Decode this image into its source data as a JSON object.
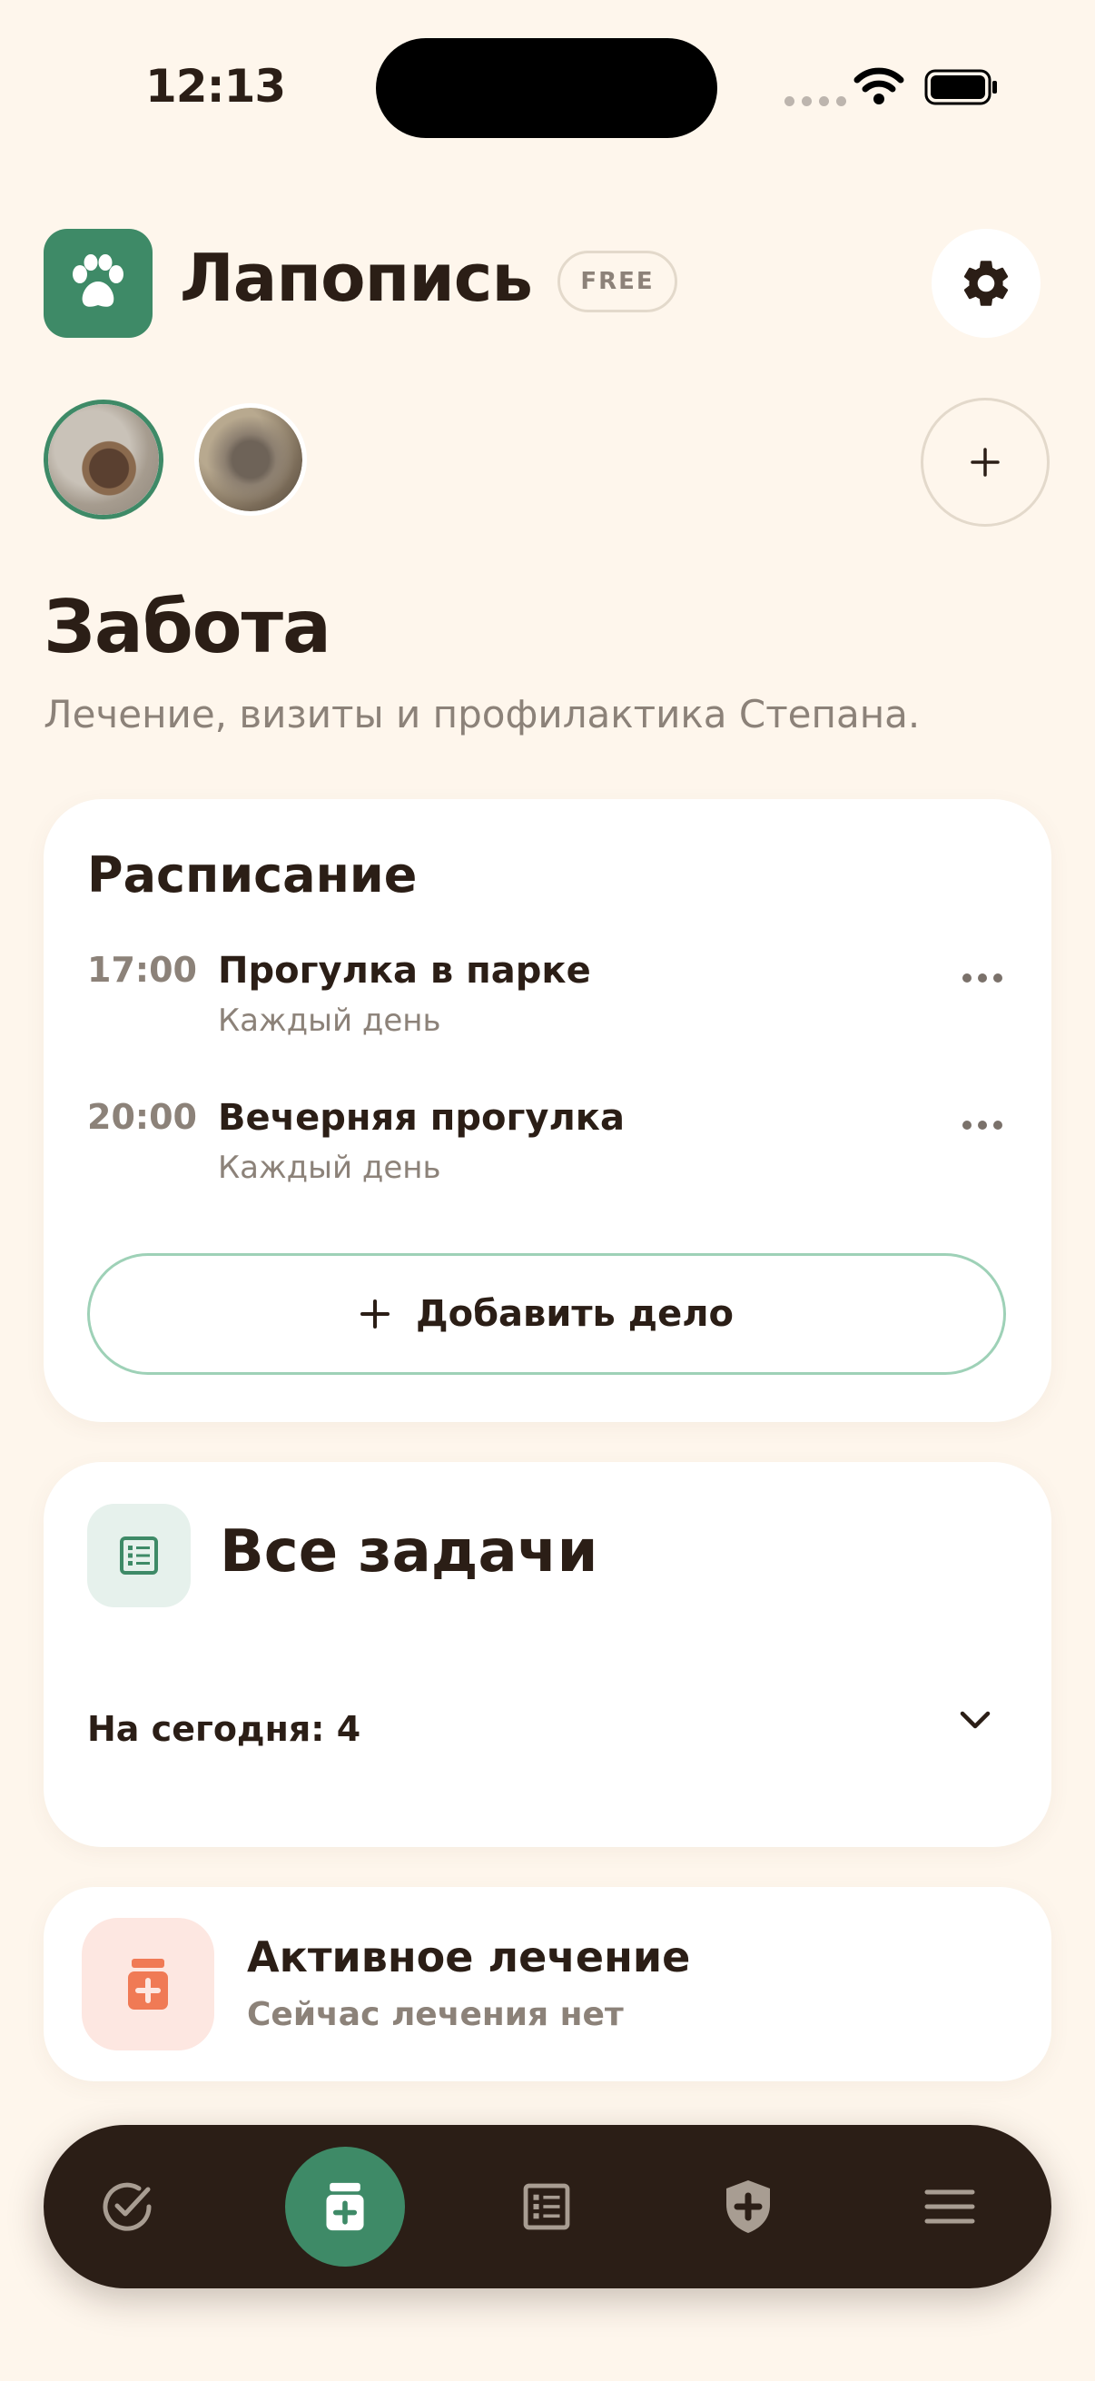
{
  "status_bar": {
    "time": "12:13"
  },
  "header": {
    "app_title": "Лапопись",
    "plan_badge": "FREE"
  },
  "page": {
    "title": "Забота",
    "subtitle": "Лечение, визиты и профилактика Степана."
  },
  "schedule": {
    "title": "Расписание",
    "items": [
      {
        "time": "17:00",
        "name": "Прогулка в парке",
        "repeat": "Каждый день"
      },
      {
        "time": "20:00",
        "name": "Вечерняя прогулка",
        "repeat": "Каждый день"
      }
    ],
    "add_button": "Добавить дело"
  },
  "tasks": {
    "title": "Все задачи",
    "today_label": "На сегодня: 4"
  },
  "treatment": {
    "title": "Активное лечение",
    "subtitle": "Сейчас лечения нет"
  },
  "colors": {
    "background": "#FEF6EC",
    "accent_green": "#3E8A67",
    "dark": "#2B1E16",
    "muted": "#8C8279",
    "treatment_orange": "#F07A55"
  },
  "icons": {
    "logo": "paw-icon",
    "settings": "gear-icon",
    "add_pet": "plus-icon",
    "tasks": "list-icon",
    "treatment": "medicine-bottle-icon",
    "tabs": [
      "check-circle-icon",
      "medicine-bottle-icon",
      "list-icon",
      "shield-icon",
      "menu-icon"
    ]
  },
  "tabs": {
    "active_index": 1
  }
}
